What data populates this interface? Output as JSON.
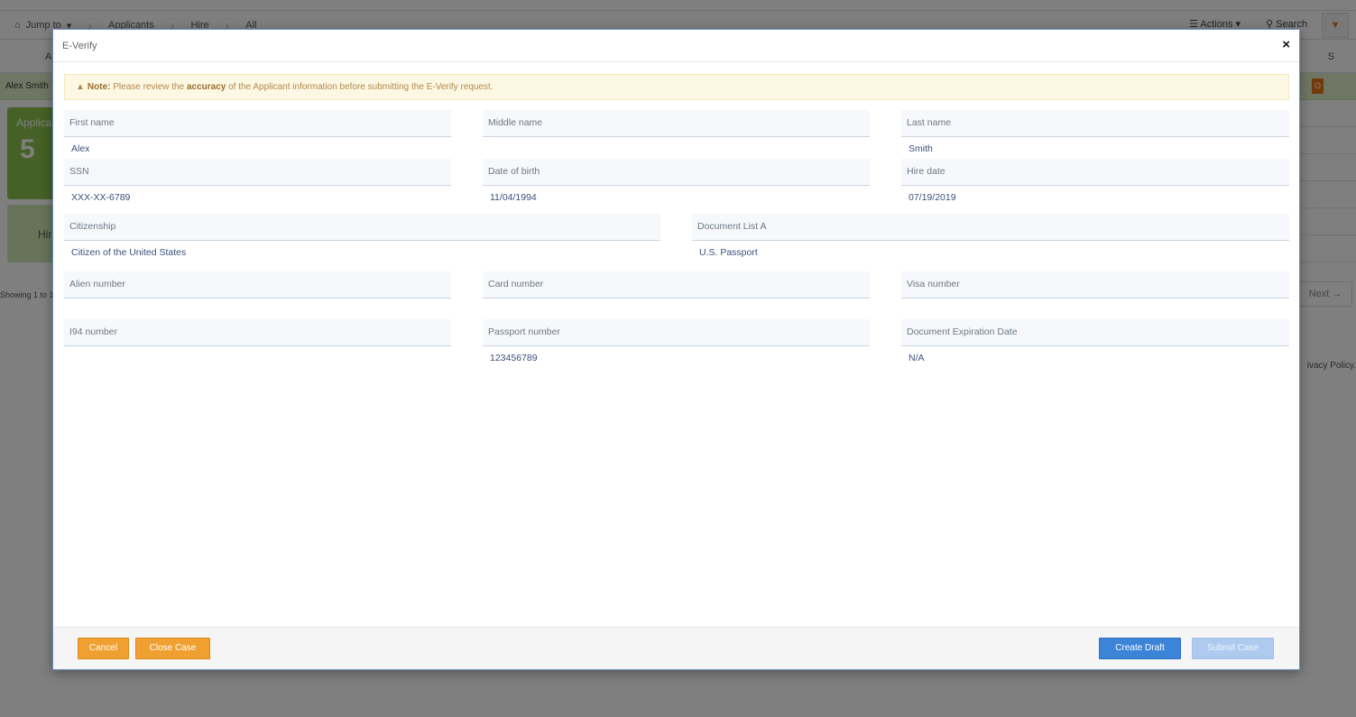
{
  "background": {
    "breadcrumb": [
      "Jump to",
      "Applicants",
      "Hire",
      "All"
    ],
    "actions_label": "Actions",
    "search_label": "Search",
    "header_left": "Ap",
    "header_right": "S",
    "selected_row_name": "Alex Smith",
    "selected_row_badge": "O",
    "card_title": "Applica",
    "card_number": "5",
    "hire_card_label": "Hir",
    "showing_text": "Showing 1 to 1",
    "next_label": "Next →",
    "privacy_text": "ivacy Policy."
  },
  "modal": {
    "title": "E-Verify",
    "close_symbol": "×",
    "note": {
      "icon": "warning-icon",
      "label": "Note:",
      "text_before": " Please review the ",
      "emphasis": "accuracy",
      "text_after": " of the Applicant information before submitting the E-Verify request."
    },
    "fields": {
      "first_name": {
        "label": "First name",
        "value": "Alex"
      },
      "middle_name": {
        "label": "Middle name",
        "value": ""
      },
      "last_name": {
        "label": "Last name",
        "value": "Smith"
      },
      "ssn": {
        "label": "SSN",
        "value": "XXX-XX-6789"
      },
      "date_of_birth": {
        "label": "Date of birth",
        "value": "11/04/1994"
      },
      "hire_date": {
        "label": "Hire date",
        "value": "07/19/2019"
      },
      "citizenship": {
        "label": "Citizenship",
        "value": "Citizen of the United States"
      },
      "document_list_a": {
        "label": "Document List A",
        "value": "U.S. Passport"
      },
      "alien_number": {
        "label": "Alien number",
        "value": ""
      },
      "card_number": {
        "label": "Card number",
        "value": ""
      },
      "visa_number": {
        "label": "Visa number",
        "value": ""
      },
      "i94_number": {
        "label": "I94 number",
        "value": ""
      },
      "passport_number": {
        "label": "Passport number",
        "value": "123456789"
      },
      "document_expiration_date": {
        "label": "Document Expiration Date",
        "value": "N/A"
      }
    },
    "footer": {
      "cancel_label": "Cancel",
      "close_case_label": "Close Case",
      "create_draft_label": "Create Draft",
      "submit_case_label": "Submit Case"
    }
  },
  "colors": {
    "accent_orange": "#f0a030",
    "primary_blue": "#3c84d8",
    "disabled_blue": "#aecbef",
    "note_bg": "#fcf8e3"
  }
}
